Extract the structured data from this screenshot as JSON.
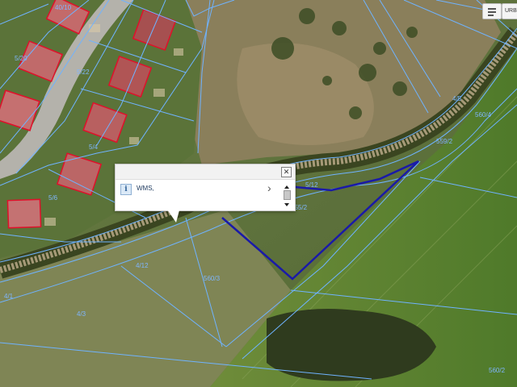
{
  "popup": {
    "layer_name": "WMS,"
  },
  "parcel_labels": [
    "40/10",
    "5/20",
    "5/22",
    "5/4",
    "5/6",
    "560/3",
    "560/2",
    "5/12",
    "4/12",
    "4/3",
    "560/4",
    "4/1",
    "4/5",
    "555/2",
    "559/2"
  ],
  "toolbar": {
    "layers_label": "URB"
  },
  "colors": {
    "parcel_lines": "#6fb3ff",
    "selected_parcel": "#1a1aa8",
    "building_outline": "#e0102a"
  }
}
